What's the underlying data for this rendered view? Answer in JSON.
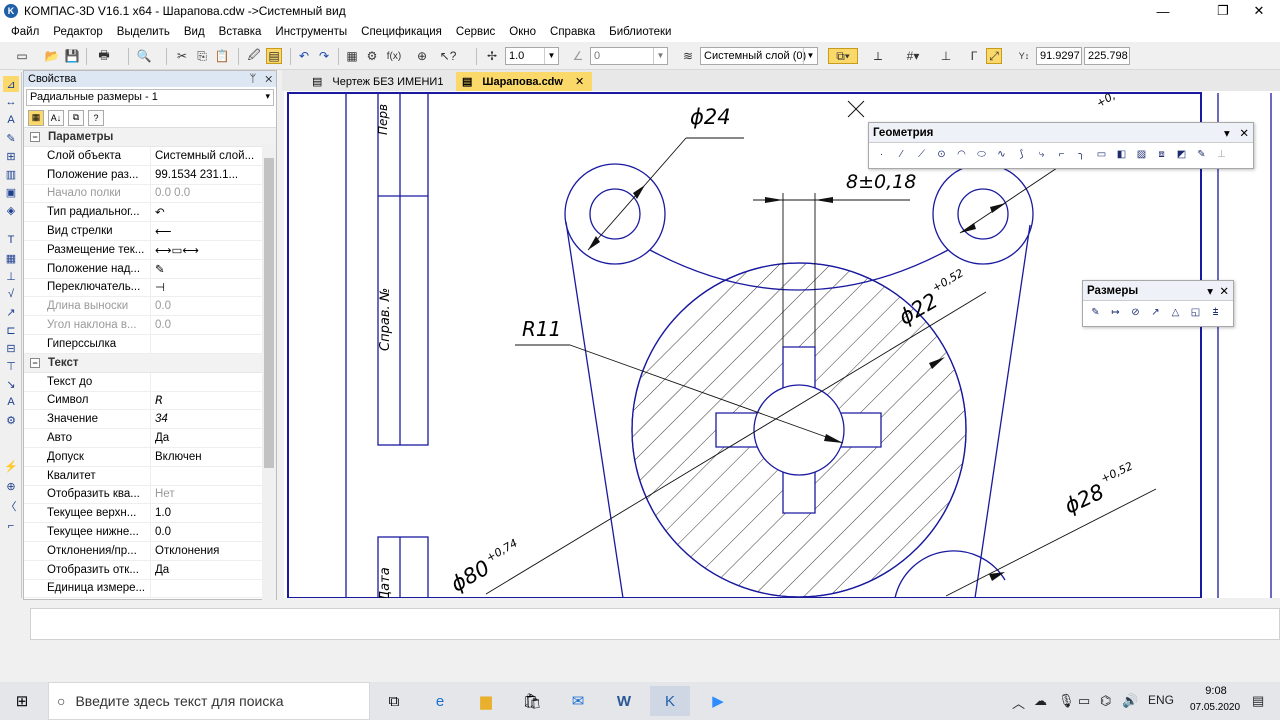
{
  "window": {
    "title": "КОМПАС-3D V16.1 x64 - Шарапова.cdw ->Системный вид",
    "app_icon": "kompas-icon",
    "minimize": "—",
    "restore": "❐",
    "close": "✕"
  },
  "menu": [
    "Файл",
    "Редактор",
    "Выделить",
    "Вид",
    "Вставка",
    "Инструменты",
    "Спецификация",
    "Сервис",
    "Окно",
    "Справка",
    "Библиотеки"
  ],
  "toolbar": {
    "step": "1.0",
    "angle": "0",
    "layer": "Системный слой (0)",
    "coord_x": "91.9297",
    "coord_y": "225.798"
  },
  "panel": {
    "title": "Свойства",
    "pin": "ᛘ",
    "close": "✕",
    "object": "Радиальные размеры - 1",
    "groups": [
      {
        "name": "Параметры",
        "toggle": "−",
        "rows": [
          {
            "name": "Слой объекта",
            "value": "Системный слой...",
            "disabled": false
          },
          {
            "name": "Положение раз...",
            "value": "99.1534     231.1...",
            "disabled": false
          },
          {
            "name": "Начало полки",
            "value": "0.0          0.0",
            "disabled": true
          },
          {
            "name": "Тип радиальног...",
            "value": "↶",
            "disabled": false
          },
          {
            "name": "Вид стрелки",
            "value": "⟵",
            "disabled": false
          },
          {
            "name": "Размещение тек...",
            "value": "⟷▭⟷",
            "disabled": false
          },
          {
            "name": "Положение над...",
            "value": "✎",
            "disabled": false
          },
          {
            "name": "Переключатель...",
            "value": "⊣",
            "disabled": false
          },
          {
            "name": "Длина выноски",
            "value": "0.0",
            "disabled": true
          },
          {
            "name": "Угол наклона в...",
            "value": "0.0",
            "disabled": true
          },
          {
            "name": "Гиперссылка",
            "value": "",
            "disabled": false
          }
        ]
      },
      {
        "name": "Текст",
        "toggle": "−",
        "rows": [
          {
            "name": "Текст до",
            "value": "",
            "disabled": false
          },
          {
            "name": "Символ",
            "value": "R",
            "disabled": false
          },
          {
            "name": "Значение",
            "value": "34",
            "disabled": false
          },
          {
            "name": "Авто",
            "value": "Да",
            "disabled": false
          },
          {
            "name": "Допуск",
            "value": "Включен",
            "disabled": false
          },
          {
            "name": "Квалитет",
            "value": "",
            "disabled": false
          },
          {
            "name": "Отобразить ква...",
            "value": "Нет",
            "disabled": true
          },
          {
            "name": "Текущее верхн...",
            "value": "1.0",
            "disabled": false
          },
          {
            "name": "Текущее нижне...",
            "value": "0.0",
            "disabled": false
          },
          {
            "name": "Отклонения/пр...",
            "value": "Отклонения",
            "disabled": false
          },
          {
            "name": "Отобразить отк...",
            "value": "Да",
            "disabled": false
          },
          {
            "name": "Единица измере...",
            "value": "",
            "disabled": false
          }
        ]
      }
    ]
  },
  "tabs": [
    {
      "label": "Чертеж БЕЗ ИМЕНИ1",
      "active": false
    },
    {
      "label": "Шарапова.cdw",
      "active": true
    }
  ],
  "drawing": {
    "dim_phi24": "ϕ24",
    "dim_8": "8±0,18",
    "dim_r11": "R11",
    "dim_phi22": "ϕ22",
    "tol_22": "+0,52",
    "dim_phi28": "ϕ28",
    "tol_28": "+0,52",
    "dim_phi80": "ϕ80",
    "tol_80": "+0,74",
    "frame_text_1": "Перв",
    "frame_text_2": "Справ. №",
    "frame_text_3": "Дата",
    "tol_top": "+0,"
  },
  "geometry_bar": {
    "title": "Геометрия",
    "icons": [
      "point-icon",
      "line-icon",
      "segment-icon",
      "circle-icon",
      "arc-icon",
      "ellipse-icon",
      "spline-icon",
      "polyline-icon",
      "curve-icon",
      "chamfer-icon",
      "fillet-icon",
      "rectangle-icon",
      "contour-icon",
      "hatch-icon",
      "equidistant-icon",
      "fill-icon",
      "collect-icon",
      "more-icon"
    ]
  },
  "dims_bar": {
    "title": "Размеры",
    "icons": [
      "auto-dim-icon",
      "linear-dim-icon",
      "diameter-dim-icon",
      "radial-dim-icon",
      "angular-dim-icon",
      "arc-dim-icon",
      "height-mark-icon"
    ]
  },
  "taskbar": {
    "search_placeholder": "Введите здесь текст для поиска",
    "lang": "ENG",
    "time": "9:08",
    "date": "07.05.2020"
  }
}
